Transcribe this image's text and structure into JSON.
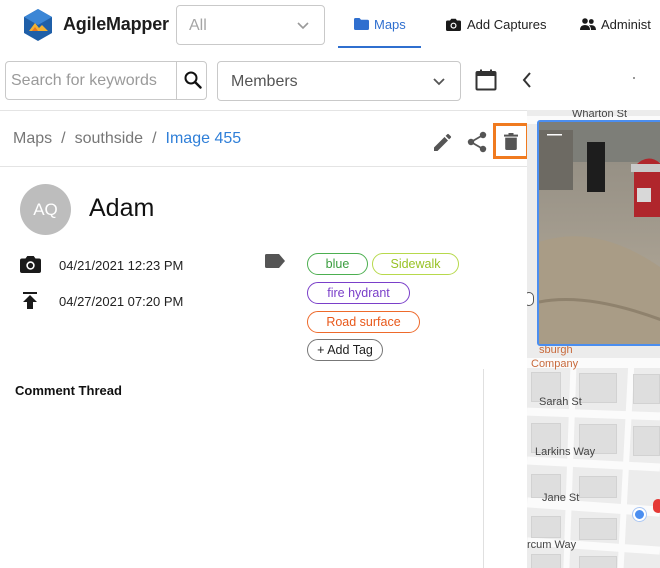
{
  "brand": {
    "name": "AgileMapper"
  },
  "filter": {
    "value": "All"
  },
  "nav": {
    "maps": "Maps",
    "add_captures": "Add Captures",
    "administration": "Administ"
  },
  "search": {
    "placeholder": "Search for keywords"
  },
  "members": {
    "value": "Members"
  },
  "breadcrumb": {
    "root": "Maps",
    "folder": "southside",
    "current": "Image 455"
  },
  "user": {
    "initials": "AQ",
    "name": "Adam"
  },
  "dates": {
    "captured": "04/21/2021 12:23 PM",
    "uploaded": "04/27/2021 07:20 PM"
  },
  "tags": [
    {
      "label": "blue",
      "color": "#3a9d3e"
    },
    {
      "label": "Sidewalk",
      "color": "#98c225"
    },
    {
      "label": "fire hydrant",
      "color": "#7a3fc9"
    },
    {
      "label": "Road surface",
      "color": "#e8581a"
    }
  ],
  "add_tag": "+ Add Tag",
  "comments": {
    "title": "Comment Thread"
  },
  "map": {
    "streets": [
      "Wharton St",
      "sburgh",
      "Company",
      "Sarah St",
      "Larkins Way",
      "Jane St",
      "rcum Way"
    ]
  },
  "colors": {
    "accent": "#2f6fcf",
    "delete_highlight": "#f07a1f",
    "link": "#2f7fd8"
  },
  "icons": [
    "folder-icon",
    "camera-icon",
    "people-icon",
    "search-icon",
    "calendar-icon",
    "chevron-left-icon",
    "edit-icon",
    "share-icon",
    "trash-icon",
    "tag-icon",
    "upload-icon"
  ]
}
